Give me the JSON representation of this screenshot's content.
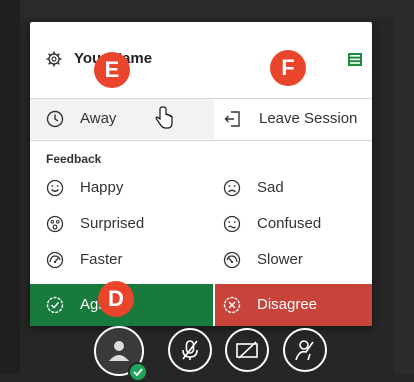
{
  "header": {
    "user_name": "Your Name"
  },
  "status_row": {
    "away_label": "Away",
    "leave_label": "Leave Session"
  },
  "feedback": {
    "title": "Feedback",
    "items": [
      {
        "label": "Happy",
        "icon": "happy-face-icon"
      },
      {
        "label": "Sad",
        "icon": "sad-face-icon"
      },
      {
        "label": "Surprised",
        "icon": "surprised-face-icon"
      },
      {
        "label": "Confused",
        "icon": "confused-face-icon"
      },
      {
        "label": "Faster",
        "icon": "faster-icon"
      },
      {
        "label": "Slower",
        "icon": "slower-icon"
      }
    ],
    "agree_label": "Agree",
    "disagree_label": "Disagree"
  },
  "callouts": {
    "e": "E",
    "f": "F",
    "d": "D"
  },
  "colors": {
    "agree": "#187a3c",
    "disagree": "#c8443a",
    "callout": "#e8452c",
    "status_ok": "#1fa55a",
    "list_icon": "#1c8a3f"
  }
}
